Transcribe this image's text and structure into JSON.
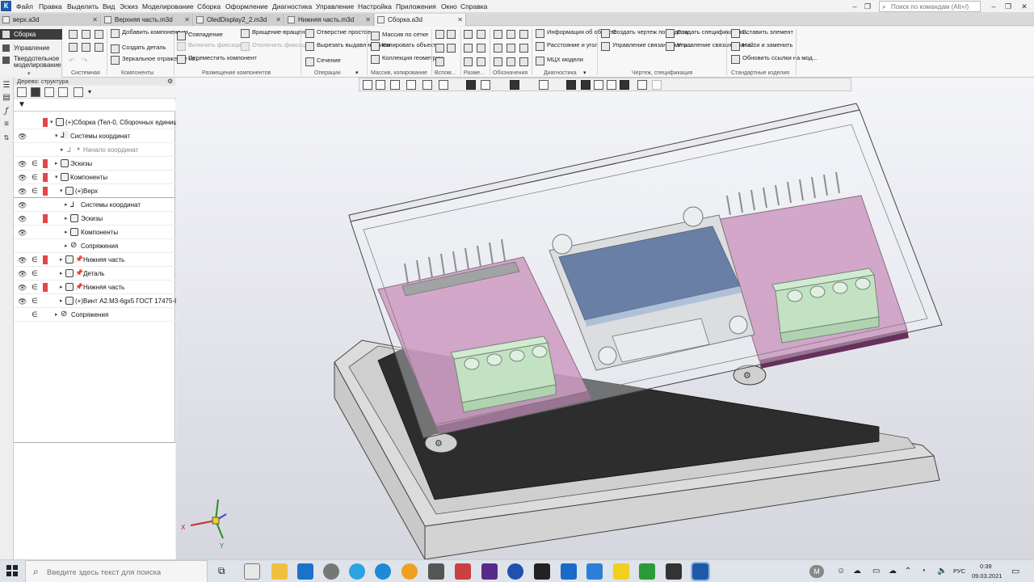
{
  "menubar": {
    "items": [
      "Файл",
      "Правка",
      "Выделить",
      "Вид",
      "Эскиз",
      "Моделирование",
      "Сборка",
      "Оформление",
      "Диагностика",
      "Управление",
      "Настройка",
      "Приложения",
      "Окно",
      "Справка"
    ],
    "search_placeholder": "Поиск по командам (Alt+/)"
  },
  "tabs": [
    {
      "label": "верх.a3d",
      "active": false
    },
    {
      "label": "Верхняя часть.m3d",
      "active": false
    },
    {
      "label": "OledDisplay2_2.m3d",
      "active": false
    },
    {
      "label": "Нижняя часть.m3d",
      "active": false
    },
    {
      "label": "Сборка.a3d",
      "active": true
    }
  ],
  "ribbon": {
    "modes": [
      "Сборка",
      "Управление",
      "Твердотельное моделирование"
    ],
    "groups": [
      "Системная",
      "Компоненты",
      "Размещение компонентов",
      "Операции",
      "Массив, копирование",
      "Вспом...",
      "Разме...",
      "Обозначения",
      "Диагностика",
      "Чертеж, спецификация",
      "Стандартные изделия"
    ],
    "components": [
      "Добавить компонент из...",
      "Создать деталь",
      "Зеркальное отражение ко..."
    ],
    "placement": [
      "Совпадение",
      "Включить фиксацию",
      "Переместить компонент",
      "Вращение-вращение",
      "Отключить фиксацию"
    ],
    "operations": [
      "Отверстие простое",
      "Вырезать выдавливанием",
      "Сечение"
    ],
    "array": [
      "Массив по сетке",
      "Копировать объекты",
      "Коллекция геометрии"
    ],
    "diagnostics": [
      "Информация об объекте",
      "Расстояние и угол",
      "МЦХ модели"
    ],
    "drawing": [
      "Создать чертеж по модели",
      "Управление связанными ч...",
      "Создать спецификацию...",
      "Управление связанными с..."
    ],
    "standard": [
      "Вставить элемент",
      "Найти и заменить",
      "Обновить ссылки на мод..."
    ]
  },
  "tree": {
    "header": "Дерево: структура",
    "rows": [
      {
        "text": "(+)Сборка (Тел-0, Сборочных единиц...",
        "indent": 0
      },
      {
        "text": "Системы координат",
        "indent": 1
      },
      {
        "text": "Начало координат",
        "indent": 2,
        "grey": true
      },
      {
        "text": "Эскизы",
        "indent": 1
      },
      {
        "text": "Компоненты",
        "indent": 1
      },
      {
        "text": "(+)Верх",
        "indent": 2,
        "selected": true
      },
      {
        "text": "Системы координат",
        "indent": 3
      },
      {
        "text": "Эскизы",
        "indent": 3
      },
      {
        "text": "Компоненты",
        "indent": 3
      },
      {
        "text": "Сопряжения",
        "indent": 3
      },
      {
        "text": "Нижняя часть",
        "indent": 2
      },
      {
        "text": "Деталь",
        "indent": 2
      },
      {
        "text": "Нижняя часть",
        "indent": 2
      },
      {
        "text": "(+)Винт А2.М3-6gx5 ГОСТ 17475-8...",
        "indent": 2
      },
      {
        "text": "Сопряжения",
        "indent": 1
      }
    ]
  },
  "taskbar": {
    "search_placeholder": "Введите здесь текст для поиска",
    "lang": "РУС",
    "time": "0:39",
    "date": "09.03.2021"
  },
  "colors": {
    "pcb_magenta": "#b86aa4",
    "oled_blue": "#1f3f7a",
    "terminal_green": "#a9d8a6",
    "ribbon_active_mode": "#3c3c3c",
    "tree_red_mark": "#e2474a"
  }
}
